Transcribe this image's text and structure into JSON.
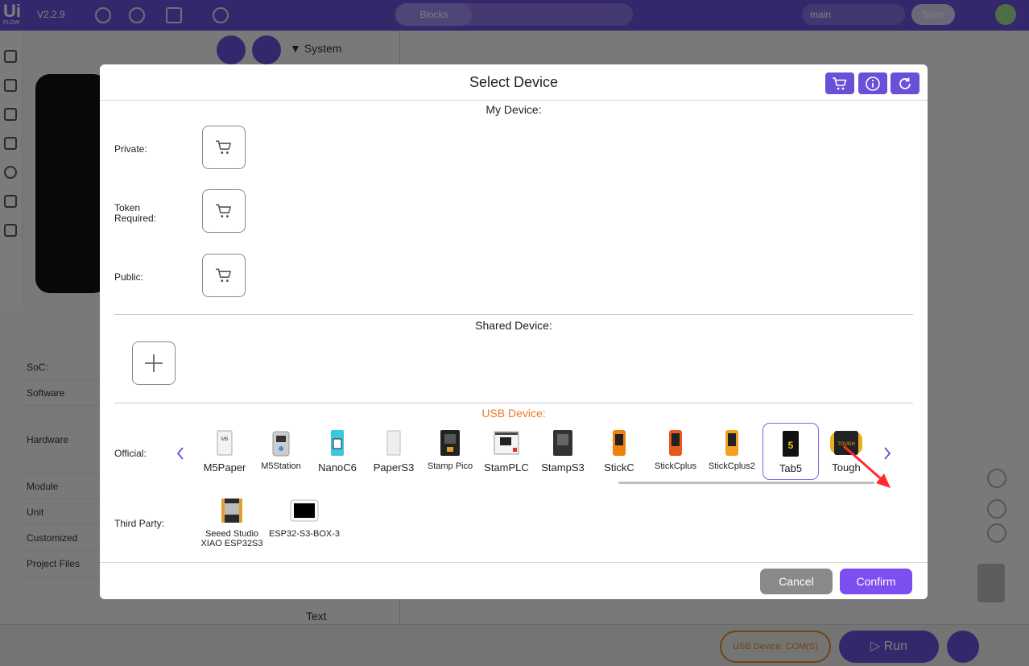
{
  "app": {
    "logo": "Ui",
    "logo_sub": "FLOW",
    "version": "V2.2.9",
    "tabs": [
      "Blocks",
      "",
      ""
    ],
    "project_name": "main",
    "save_label": "Save",
    "system_label": "System",
    "text_label": "Text",
    "props": [
      "SoC:",
      "Software",
      "Hardware",
      "Module",
      "Unit",
      "Customized",
      "Project Files"
    ],
    "usb_status": "USB Device: COM(S)",
    "run_label": "Run"
  },
  "dialog": {
    "title": "Select Device",
    "my_device_title": "My Device:",
    "private_label": "Private:",
    "token_label": "Token Required:",
    "public_label": "Public:",
    "shared_title": "Shared Device:",
    "usb_title": "USB Device:",
    "official_label": "Official:",
    "third_party_label": "Third Party:",
    "official_devices": [
      {
        "name": "M5Paper",
        "icon": "m5paper-device-icon"
      },
      {
        "name": "M5Station",
        "icon": "m5station-device-icon"
      },
      {
        "name": "NanoC6",
        "icon": "nanoc6-device-icon"
      },
      {
        "name": "PaperS3",
        "icon": "papers3-device-icon"
      },
      {
        "name": "Stamp Pico",
        "icon": "stamp-pico-device-icon"
      },
      {
        "name": "StamPLC",
        "icon": "stamplc-device-icon"
      },
      {
        "name": "StampS3",
        "icon": "stamps3-device-icon"
      },
      {
        "name": "StickC",
        "icon": "stickc-device-icon"
      },
      {
        "name": "StickCplus",
        "icon": "stickcplus-device-icon"
      },
      {
        "name": "StickCplus2",
        "icon": "stickcplus2-device-icon"
      },
      {
        "name": "Tab5",
        "icon": "tab5-device-icon",
        "selected": true
      },
      {
        "name": "Tough",
        "icon": "tough-device-icon"
      }
    ],
    "third_party_devices": [
      {
        "name": "Seeed Studio XIAO ESP32S3",
        "icon": "xiao-esp32s3-device-icon"
      },
      {
        "name": "ESP32-S3-BOX-3",
        "icon": "esp32-s3-box3-device-icon"
      }
    ],
    "cancel_label": "Cancel",
    "confirm_label": "Confirm"
  },
  "colors": {
    "accent": "#6a4fd8",
    "usb_title": "#f07820",
    "selected_border": "#7b64e4",
    "annotation_arrow": "#ff2a2a"
  }
}
